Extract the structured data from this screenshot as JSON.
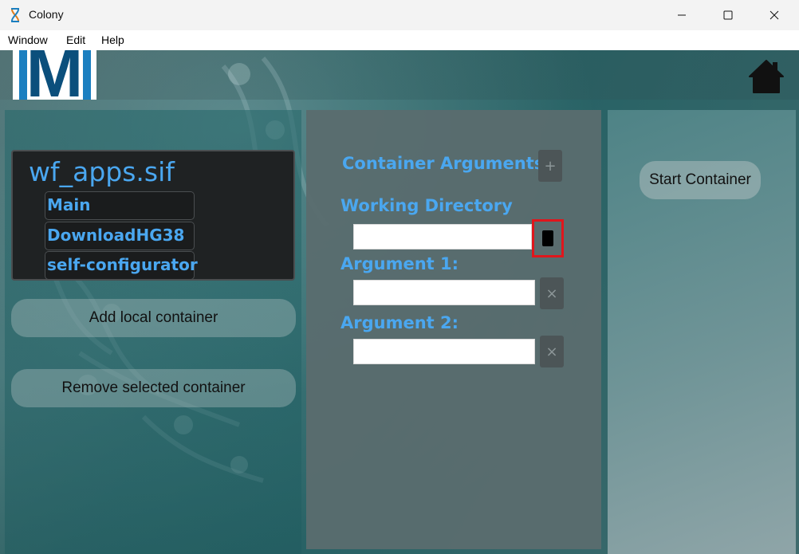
{
  "window": {
    "title": "Colony",
    "app_icon": "dna-icon"
  },
  "menu": {
    "items": [
      "Window",
      "Edit",
      "Help"
    ]
  },
  "header": {
    "logo_letter": "M",
    "home_icon": "home-icon"
  },
  "container_list": {
    "selected_container": "wf_apps.sif",
    "apps": [
      "Main",
      "DownloadHG38",
      "self-configurator"
    ]
  },
  "left_actions": {
    "add_label": "Add local container",
    "remove_label": "Remove selected container"
  },
  "arguments_panel": {
    "title": "Container Arguments",
    "add_symbol": "+",
    "working_directory_label": "Working Directory",
    "working_directory_value": "",
    "argument1_label": "Argument 1:",
    "argument1_value": "",
    "argument2_label": "Argument 2:",
    "argument2_value": "",
    "remove_symbol": "×"
  },
  "right_panel": {
    "start_label": "Start Container"
  },
  "colors": {
    "accent_blue": "#4aa7f0",
    "highlight_red": "#e0161c",
    "logo_blue": "#1b7fc0"
  }
}
